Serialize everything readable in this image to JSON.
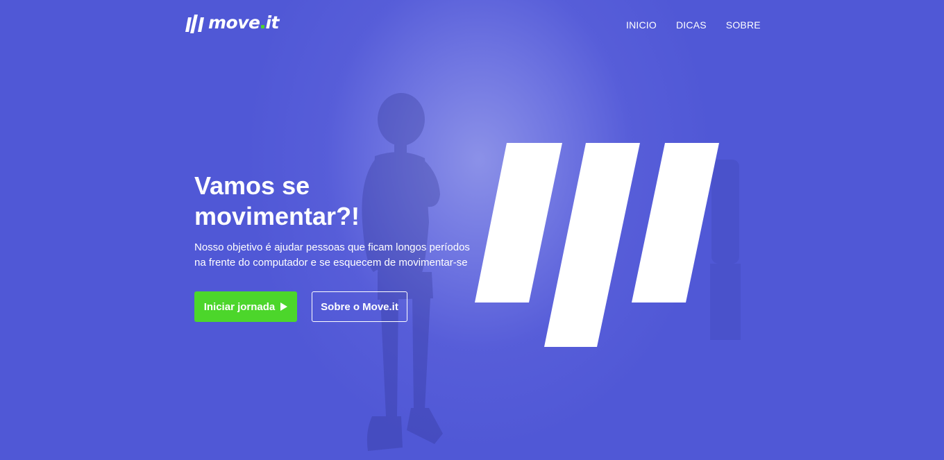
{
  "header": {
    "logo_text": "move",
    "logo_suffix": "it",
    "nav": [
      {
        "label": "INICIO"
      },
      {
        "label": "DICAS"
      },
      {
        "label": "SOBRE"
      }
    ]
  },
  "hero": {
    "title_line1": "Vamos se",
    "title_line2": "movimentar?!",
    "description_line1": "Nosso objetivo é ajudar pessoas que ficam longos períodos",
    "description_line2": "na frente do computador e se esquecem de movimentar-se",
    "primary_button": "Iniciar jornada",
    "secondary_button": "Sobre o Move.it"
  },
  "colors": {
    "background": "#5058d6",
    "accent_green": "#4cd62b",
    "text": "#ffffff"
  },
  "icons": {
    "logo": "three-slanted-bars-logo-icon",
    "play": "play-icon",
    "hero_mark": "three-slanted-bars-mark-icon"
  }
}
